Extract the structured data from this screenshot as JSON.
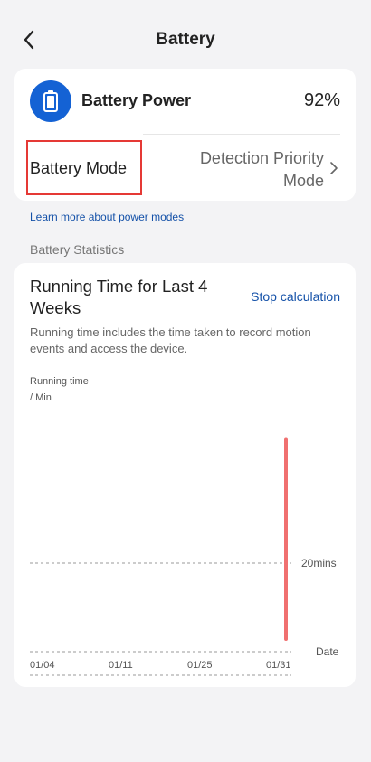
{
  "header": {
    "title": "Battery",
    "back_icon": "chevron-left-icon"
  },
  "power_card": {
    "icon": "battery-icon",
    "icon_bg_color": "#1462d4",
    "label": "Battery Power",
    "value": "92%",
    "mode_label": "Battery Mode",
    "mode_value": "Detection Priority Mode",
    "highlight_color": "#e53935"
  },
  "learn_more_link": "Learn more about power modes",
  "statistics": {
    "section_title": "Battery Statistics",
    "card_title": "Running Time for Last 4 Weeks",
    "stop_button": "Stop calculation",
    "description": "Running time includes the time taken to record motion events and access the device."
  },
  "chart_data": {
    "type": "bar",
    "ylabel_line1": "Running time",
    "ylabel_line2": "/ Min",
    "xlabel": "Date",
    "x_tick_labels": [
      "01/04",
      "01/11",
      "01/25",
      "01/31"
    ],
    "reference_line": {
      "value": 20,
      "label": "20mins"
    },
    "bar_color": "#f07070",
    "bars": [
      {
        "date": "01/31",
        "value": 45
      }
    ]
  }
}
